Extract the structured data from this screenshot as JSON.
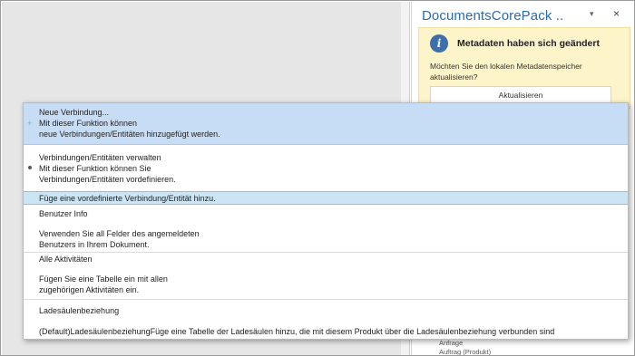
{
  "task_pane": {
    "title": "DocumentsCorePack ..",
    "dropdown_icon": "chevron-down-icon",
    "close_icon": "close-icon",
    "dropdown_glyph": "▾",
    "close_glyph": "×",
    "notice": {
      "icon": "info-icon",
      "icon_glyph": "i",
      "heading": "Metadaten haben sich geändert",
      "body_line1": "Möchten Sie den lokalen Metadatenspeicher",
      "body_line2": "aktualisieren?",
      "button": "Aktualisieren"
    },
    "bottom_line1": "Anfrage",
    "bottom_line2": "Auftrag (Produkt)"
  },
  "menu": {
    "new_connection": {
      "title": "Neue Verbindung...",
      "line2": "Mit dieser Funktion können",
      "line3": "neue Verbindungen/Entitäten hinzugefügt werden.",
      "icon_glyph": "+"
    },
    "manage_connections": {
      "title": "Verbindungen/Entitäten verwalten",
      "line2": "Mit dieser Funktion können Sie",
      "line3": " Verbindungen/Entitäten vordefinieren."
    },
    "predefined": {
      "title": "Füge eine vordefinierte Verbindung/Entität hinzu."
    },
    "user_info": {
      "title": "Benutzer Info",
      "line2": "Verwenden Sie all Felder des angemeldeten",
      "line3": "Benutzers in Ihrem Dokument."
    },
    "all_activities": {
      "title": "Alle Aktivitäten",
      "line2": "Fügen Sie eine Tabelle ein mit allen",
      "line3": "zugehörigen Aktivitäten ein."
    },
    "ladesaeulen": {
      "title": "Ladesäulenbeziehung",
      "line2": "(Default)LadesäulenbeziehungFüge eine Tabelle der Ladesäulen hinzu, die mit diesem Produkt über die Ladesäulenbeziehung verbunden sind"
    }
  },
  "colors": {
    "accent": "#2b6cb0",
    "highlight": "#c7ddf5",
    "notice_bg": "#fdf4c9",
    "info_icon": "#3e6faa"
  }
}
